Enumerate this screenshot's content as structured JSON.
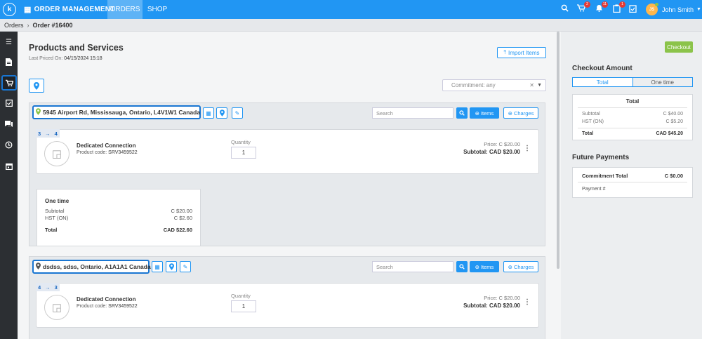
{
  "topbar": {
    "logo": "k",
    "app_name": "ORDER MANAGEMENT",
    "tabs": [
      {
        "label": "ORDERS",
        "active": true
      },
      {
        "label": "SHOP",
        "active": false
      }
    ],
    "notifications": {
      "cart": "2",
      "bell": "11",
      "clipboard": "1"
    },
    "user": {
      "initials": "JS",
      "name": "John Smith"
    }
  },
  "breadcrumb": {
    "root": "Orders",
    "current": "Order #16400"
  },
  "main": {
    "title": "Products and Services",
    "last_priced_label": "Last Priced On:",
    "last_priced_value": "04/15/2024 15:18",
    "import_label": "Import Items",
    "commitment_placeholder": "Commitment: any",
    "locations": [
      {
        "address": "5945 Airport Rd, Mississauga, Ontario, L4V1W1 Canada",
        "search_placeholder": "Search",
        "items_label": "Items",
        "charges_label": "Charges",
        "item": {
          "seq_from": "3",
          "seq_to": "4",
          "name": "Dedicated Connection",
          "code_label": "Product code:",
          "code": "SRV3459522",
          "quantity_label": "Quantity",
          "quantity": "1",
          "price_label": "Price:",
          "price": "C $20.00",
          "subtotal_label": "Subtotal:",
          "subtotal": "CAD $20.00"
        },
        "onetime": {
          "title": "One time",
          "subtotal_label": "Subtotal",
          "subtotal": "C $20.00",
          "tax_label": "HST (ON)",
          "tax": "C $2.60",
          "total_label": "Total",
          "total": "CAD $22.60"
        }
      },
      {
        "address": "dsdss, sdss, Ontario, A1A1A1 Canada",
        "search_placeholder": "Search",
        "items_label": "Items",
        "charges_label": "Charges",
        "item": {
          "seq_from": "4",
          "seq_to": "3",
          "name": "Dedicated Connection",
          "code_label": "Product code:",
          "code": "SRV3459522",
          "quantity_label": "Quantity",
          "quantity": "1",
          "price_label": "Price:",
          "price": "C $20.00",
          "subtotal_label": "Subtotal:",
          "subtotal": "CAD $20.00"
        }
      }
    ]
  },
  "right_panel": {
    "checkout_label": "Checkout",
    "checkout_amount_title": "Checkout Amount",
    "toggle": [
      "Total",
      "One time"
    ],
    "total_box": {
      "title": "Total",
      "subtotal_label": "Subtotal",
      "subtotal": "C $40.00",
      "tax_label": "HST (ON)",
      "tax": "C $5.20",
      "total_label": "Total",
      "total": "CAD $45.20"
    },
    "future_title": "Future Payments",
    "commitment_total_label": "Commitment Total",
    "commitment_total": "C $0.00",
    "payment_label": "Payment #"
  },
  "colors": {
    "primary": "#2196f3",
    "checkout": "#8bc34a",
    "sidebar": "#2c2f33",
    "highlight": "#1976d2"
  }
}
